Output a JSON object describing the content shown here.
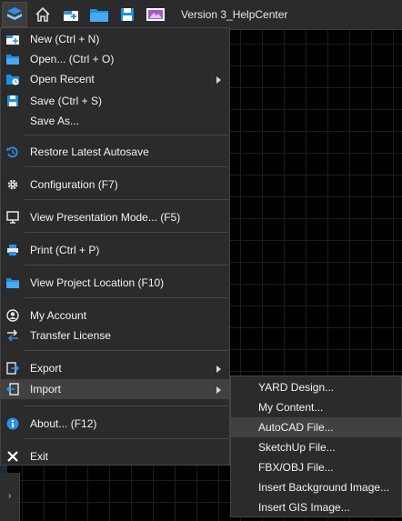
{
  "toolbar": {
    "title": "Version 3_HelpCenter",
    "buttons": [
      "app-menu-icon",
      "home-icon",
      "new-document-icon",
      "folder-icon",
      "save-icon",
      "presentation-icon"
    ]
  },
  "menu": {
    "items": [
      {
        "label": "New (Ctrl + N)",
        "icon": "new-document-icon"
      },
      {
        "label": "Open... (Ctrl + O)",
        "icon": "folder-icon"
      },
      {
        "label": "Open Recent",
        "icon": "recent-folder-icon",
        "submenu": true
      },
      {
        "label": "Save (Ctrl + S)",
        "icon": "save-icon"
      },
      {
        "label": "Save As...",
        "icon": ""
      },
      {
        "label": "Restore Latest Autosave",
        "icon": "restore-icon"
      },
      {
        "label": "Configuration (F7)",
        "icon": "gear-icon"
      },
      {
        "label": "View Presentation Mode... (F5)",
        "icon": "presentation-icon"
      },
      {
        "label": "Print (Ctrl + P)",
        "icon": "printer-icon"
      },
      {
        "label": "View Project Location (F10)",
        "icon": "folder-location-icon"
      },
      {
        "label": "My Account",
        "icon": "account-icon"
      },
      {
        "label": "Transfer License",
        "icon": "transfer-icon"
      },
      {
        "label": "Export",
        "icon": "export-icon",
        "submenu": true
      },
      {
        "label": "Import",
        "icon": "import-icon",
        "submenu": true
      },
      {
        "label": "About... (F12)",
        "icon": "info-icon"
      },
      {
        "label": "Exit",
        "icon": "close-icon"
      }
    ]
  },
  "import_submenu": {
    "items": [
      "YARD Design...",
      "My Content...",
      "AutoCAD File...",
      "SketchUp File...",
      "FBX/OBJ File...",
      "Insert Background Image...",
      "Insert GIS Image..."
    ]
  },
  "colors": {
    "accent": "#2f8fe6",
    "menu_bg": "#2b2b2b",
    "hover_bg": "#414141"
  }
}
